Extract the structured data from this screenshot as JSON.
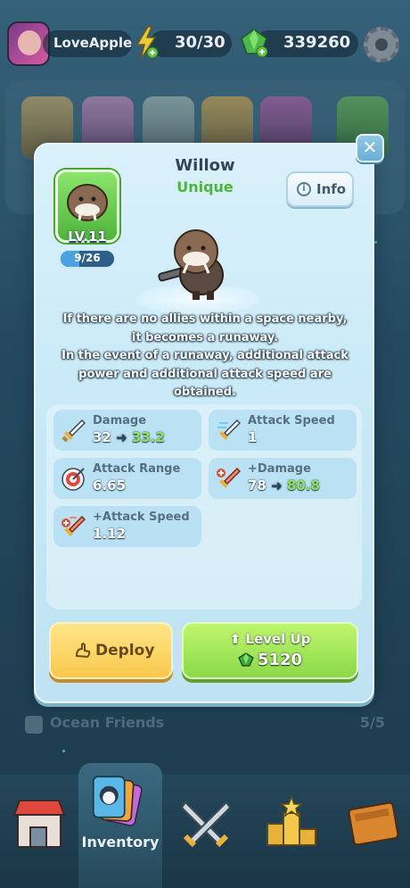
{
  "top_bar": {
    "player_name": "LoveApple",
    "energy": "30/30",
    "gems": "339260",
    "icons": {
      "energy": "lightning-plus-icon",
      "gems": "gem-plus-icon",
      "settings": "gear-icon"
    }
  },
  "background": {
    "collection_label": "Ocean Friends",
    "collection_count": "5/5"
  },
  "modal": {
    "name": "Willow",
    "rarity": "Unique",
    "info_label": "Info",
    "level": "LV.11",
    "xp": "9/26",
    "xp_fraction": 0.346,
    "description": [
      "If there are no allies within a space nearby,",
      "it becomes a runaway.",
      "In the event of a runaway, additional attack",
      "power and additional attack speed are",
      "obtained."
    ],
    "stats": [
      {
        "label": "Damage",
        "value": "32",
        "arrow": "➜",
        "new_value": "33.2",
        "icon": "sword-icon"
      },
      {
        "label": "Attack Speed",
        "value": "1",
        "icon": "speed-sword-icon"
      },
      {
        "label": "Attack Range",
        "value": "6.65",
        "icon": "target-icon"
      },
      {
        "label": "+Damage",
        "value": "78",
        "arrow": "➜",
        "new_value": "80.8",
        "icon": "sword-plus-icon"
      },
      {
        "label": "+Attack Speed",
        "value": "1.12",
        "icon": "speed-sword-plus-icon"
      }
    ],
    "deploy_label": "Deploy",
    "level_up_label": "Level Up",
    "level_up_cost": "5120",
    "close_symbol": "✕"
  },
  "nav": {
    "active_label": "Inventory",
    "items": [
      "shop-icon",
      "inventory-icon",
      "battle-icon",
      "ranking-icon",
      "book-icon"
    ]
  },
  "colors": {
    "rarity": "#4cb53a",
    "stat_increase": "#8ee35c",
    "deploy": "#f8c84d",
    "level_up": "#8bd94a"
  }
}
